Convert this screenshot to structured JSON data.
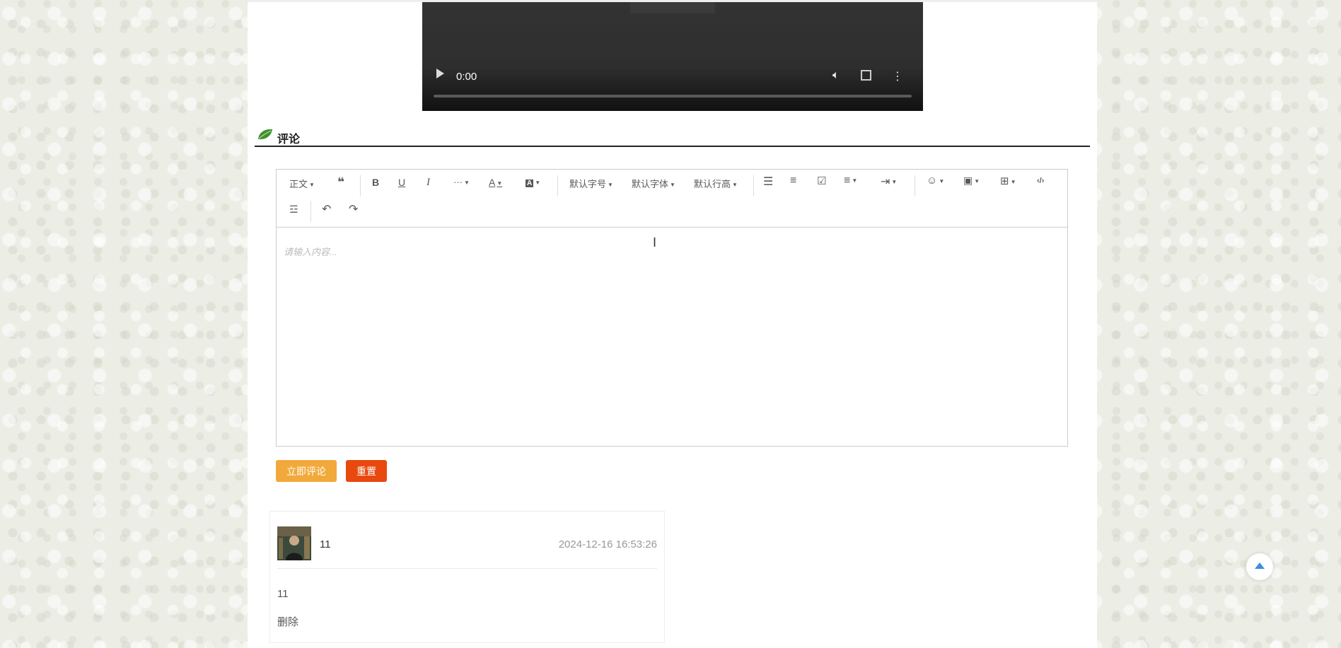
{
  "video": {
    "time": "0:00"
  },
  "section": {
    "title": "评论"
  },
  "editor": {
    "toolbar": {
      "paragraph": "正文",
      "font_size": "默认字号",
      "font_family": "默认字体",
      "line_height": "默认行高"
    },
    "placeholder": "请输入内容..."
  },
  "buttons": {
    "submit": "立即评论",
    "reset": "重置"
  },
  "comments": [
    {
      "user": "11",
      "time": "2024-12-16 16:53:26",
      "text": "11",
      "delete": "删除"
    }
  ],
  "colors": {
    "submit": "#f2a93b",
    "reset": "#e8490f",
    "accent": "#3a8ee6"
  }
}
